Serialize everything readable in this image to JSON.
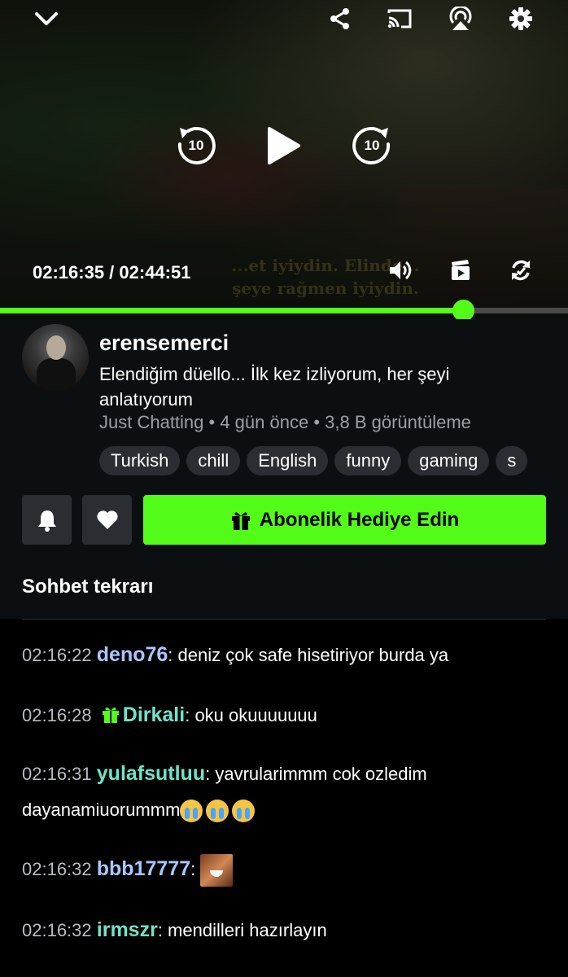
{
  "player": {
    "subtitle_line1": "...et iyiydin. Elinde...",
    "subtitle_line2": "şeye rağmen iyiydin.",
    "current_time": "02:16:35",
    "duration": "02:44:51",
    "time_text": "02:16:35 / 02:44:51",
    "seek_back_label": "10",
    "seek_forward_label": "10",
    "progress_fraction": 0.815,
    "icons": {
      "collapse": "chevron-down-icon",
      "share": "share-icon",
      "cast": "cast-icon",
      "airplay": "airplay-icon",
      "settings": "gear-icon",
      "volume": "volume-icon",
      "clip": "clip-icon",
      "rotate": "rotate-icon"
    }
  },
  "channel": {
    "name": "erensemerci",
    "title": "Elendiğim düello... İlk kez izliyorum, her şeyi anlatıyorum",
    "meta": "Just Chatting • 4 gün önce • 3,8 B görüntüleme",
    "tags": [
      "Turkish",
      "chill",
      "English",
      "funny",
      "gaming",
      "s"
    ]
  },
  "actions": {
    "gift_label": "Abonelik Hediye Edin",
    "bell_icon": "bell-icon",
    "heart_icon": "heart-icon"
  },
  "chat": {
    "section_title": "Sohbet tekrarı",
    "messages": [
      {
        "time": "02:16:22",
        "user": "deno76",
        "color": "#a9c7ff",
        "text": "deniz çok safe hisetiriyor burda ya"
      },
      {
        "time": "02:16:28",
        "user": "Dirkali",
        "color": "#6fe3c9",
        "badge": "gift-badge-icon",
        "text": "oku okuuuuuuu"
      },
      {
        "time": "02:16:31",
        "user": "yulafsutluu",
        "color": "#6fe3c9",
        "text": "yavrularimmm cok ozledim",
        "text2": "dayanamiuorummm",
        "emojis": [
          "crying-face-emoji",
          "crying-face-emoji",
          "crying-face-emoji"
        ]
      },
      {
        "time": "02:16:32",
        "user": "bbb17777",
        "color": "#a9c7ff",
        "emote": "laughing-emote"
      },
      {
        "time": "02:16:32",
        "user": "irmszr",
        "color": "#6fe3c9",
        "text": "mendilleri hazırlayın"
      }
    ]
  },
  "colors": {
    "accent": "#53fc18",
    "panel": "#0c0f12",
    "button_dark": "#2a2d31"
  }
}
